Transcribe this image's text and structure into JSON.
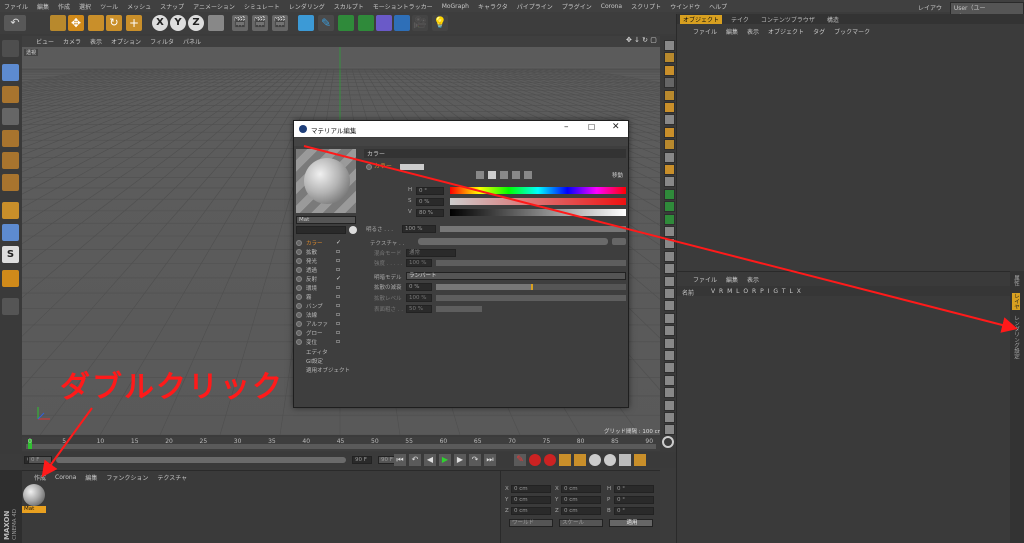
{
  "menubar": {
    "items": [
      "ファイル",
      "編集",
      "作成",
      "選択",
      "ツール",
      "メッシュ",
      "スナップ",
      "アニメーション",
      "シミュレート",
      "レンダリング",
      "スカルプト",
      "モーショントラッカー",
      "MoGraph",
      "キャラクタ",
      "パイプライン",
      "プラグイン",
      "Corona",
      "スクリプト",
      "ウインドウ",
      "ヘルプ"
    ],
    "layout_label": "レイアウト:",
    "layout_value": "User（ユーザ）"
  },
  "viewport": {
    "menu": [
      "ビュー",
      "カメラ",
      "表示",
      "オプション",
      "フィルタ",
      "パネル"
    ],
    "camera_tag": "透視",
    "grid_spacing": "グリッド間隔 : 100 cm"
  },
  "toolbar": {
    "axis_x": "X",
    "axis_y": "Y",
    "axis_z": "Z"
  },
  "material_dialog": {
    "title": "マテリアル編集",
    "material_name": "Mat",
    "channels": [
      {
        "label": "カラー",
        "checked": true
      },
      {
        "label": "拡散",
        "checked": false
      },
      {
        "label": "発光",
        "checked": false
      },
      {
        "label": "透過",
        "checked": false
      },
      {
        "label": "反射",
        "checked": true
      },
      {
        "label": "環境",
        "checked": false
      },
      {
        "label": "霧",
        "checked": false
      },
      {
        "label": "バンプ",
        "checked": false
      },
      {
        "label": "法線",
        "checked": false
      },
      {
        "label": "アルファ",
        "checked": false
      },
      {
        "label": "グロー",
        "checked": false
      },
      {
        "label": "変位",
        "checked": false
      }
    ],
    "extra_items": [
      "エディタ",
      "GI設定",
      "適用オブジェクト"
    ],
    "section_title": "カラー",
    "color_label": "カラー",
    "h_label": "H",
    "h_value": "0 °",
    "s_label": "S",
    "s_value": "0 %",
    "v_label": "V",
    "v_value": "80 %",
    "brightness_label": "明るさ . . .",
    "brightness_value": "100 %",
    "texture_label": "テクスチャ . .",
    "mix_mode_label": "混合モード",
    "mix_mode_value": "通常",
    "mix_strength_label": "強度 . . . . .",
    "mix_strength_value": "100 %",
    "model_label": "明暗モデル",
    "model_value": "ランバート",
    "diffuse_falloff_label": "拡散の減衰",
    "diffuse_falloff_value": "0 %",
    "diffuse_level_label": "拡散レベル",
    "diffuse_level_value": "100 %",
    "roughness_label": "表面粗さ . .",
    "roughness_value": "50 %",
    "mix_button": "移動"
  },
  "objects_panel": {
    "tabs": [
      "オブジェクト",
      "テイク",
      "コンテンツブラウザ",
      "構造"
    ],
    "menu": [
      "ファイル",
      "編集",
      "表示",
      "オブジェクト",
      "タグ",
      "ブックマーク"
    ]
  },
  "attributes_panel": {
    "menu": [
      "ファイル",
      "編集",
      "表示"
    ],
    "header": "名前",
    "columns": "V R M L O R P I G T L X"
  },
  "right_strip": {
    "tabs": [
      "属性",
      "レイヤ",
      "レンダリング設定"
    ]
  },
  "timeline": {
    "ticks": [
      "0",
      "5",
      "10",
      "15",
      "20",
      "25",
      "30",
      "35",
      "40",
      "45",
      "50",
      "55",
      "60",
      "65",
      "70",
      "75",
      "80",
      "85",
      "90"
    ],
    "current_frame": "0 F",
    "start_frame": "0 F",
    "end_frame": "90 F",
    "max_frame": "90 F"
  },
  "material_manager": {
    "menu": [
      "作成",
      "Corona",
      "編集",
      "ファンクション",
      "テクスチャ"
    ],
    "material_name": "Mat"
  },
  "coordinates": {
    "pos_x": "0 cm",
    "pos_y": "0 cm",
    "pos_z": "0 cm",
    "size_x": "0 cm",
    "size_y": "0 cm",
    "size_z": "0 cm",
    "rot_h": "0 °",
    "rot_p": "0 °",
    "rot_b": "0 °",
    "mode": "ワールド",
    "scale_mode": "スケール",
    "apply": "適用"
  },
  "brand": {
    "name": "MAXON",
    "product": "CINEMA 4D"
  },
  "annotation": {
    "text": "ダブルクリック",
    "color": "#ff1a1a"
  }
}
